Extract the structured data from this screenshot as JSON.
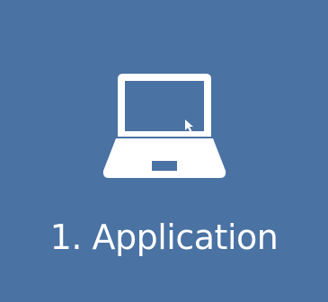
{
  "tile": {
    "label": "1. Application",
    "icon": "laptop-icon",
    "background_color": "#4a72a3",
    "foreground_color": "#ffffff"
  }
}
